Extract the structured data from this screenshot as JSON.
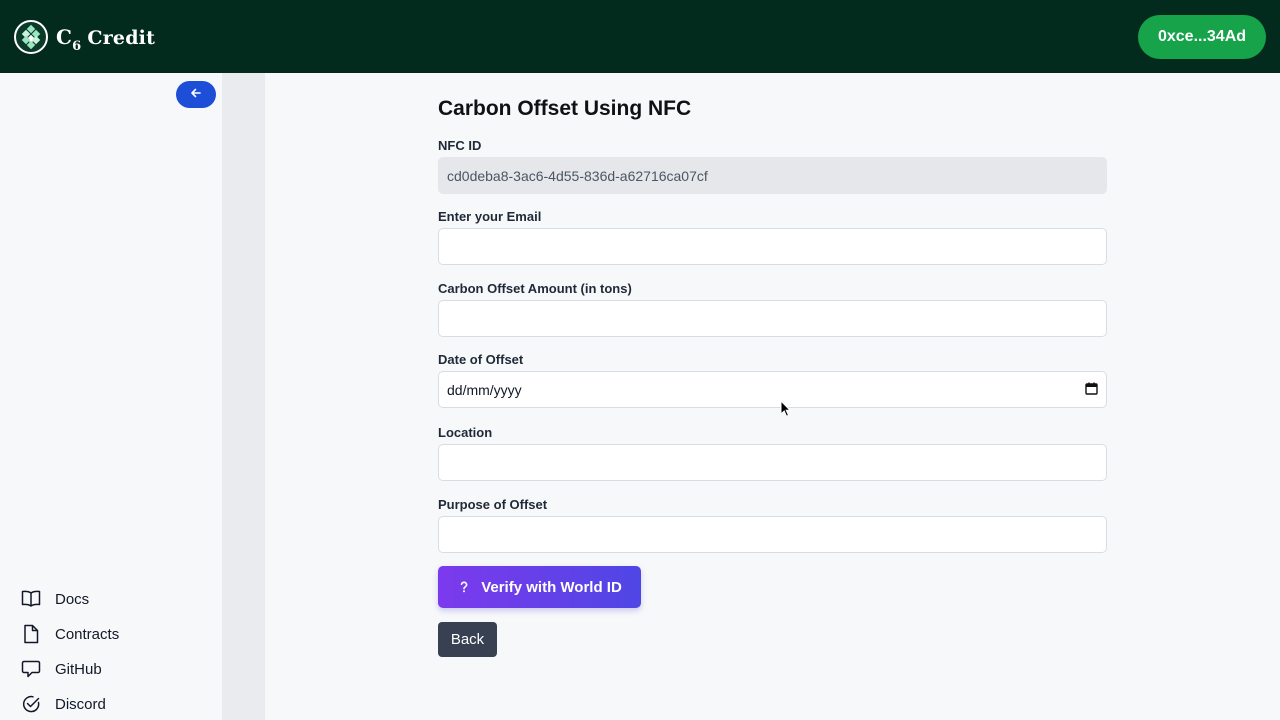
{
  "app": {
    "logo_c": "C",
    "logo_sub": "6",
    "logo_word": "Credit"
  },
  "header": {
    "wallet_label": "0xce...34Ad"
  },
  "sidebar": {
    "items": [
      {
        "label": "Docs",
        "icon": "book-icon"
      },
      {
        "label": "Contracts",
        "icon": "file-icon"
      },
      {
        "label": "GitHub",
        "icon": "github-icon"
      },
      {
        "label": "Discord",
        "icon": "discord-icon"
      }
    ]
  },
  "form": {
    "title": "Carbon Offset Using NFC",
    "nfc_label": "NFC ID",
    "nfc_value": "cd0deba8-3ac6-4d55-836d-a62716ca07cf",
    "email_label": "Enter your Email",
    "email_value": "",
    "amount_label": "Carbon Offset Amount (in tons)",
    "amount_value": "",
    "date_label": "Date of Offset",
    "date_placeholder": "dd/mm/yyyy",
    "location_label": "Location",
    "location_value": "",
    "purpose_label": "Purpose of Offset",
    "purpose_value": "",
    "verify_label": "Verify with World ID",
    "back_label": "Back"
  },
  "colors": {
    "topbar": "#032b1d",
    "wallet": "#16a34a",
    "collapse": "#1d4ed8",
    "verify_start": "#7c3aed",
    "verify_end": "#4f46e5",
    "back": "#374151"
  }
}
